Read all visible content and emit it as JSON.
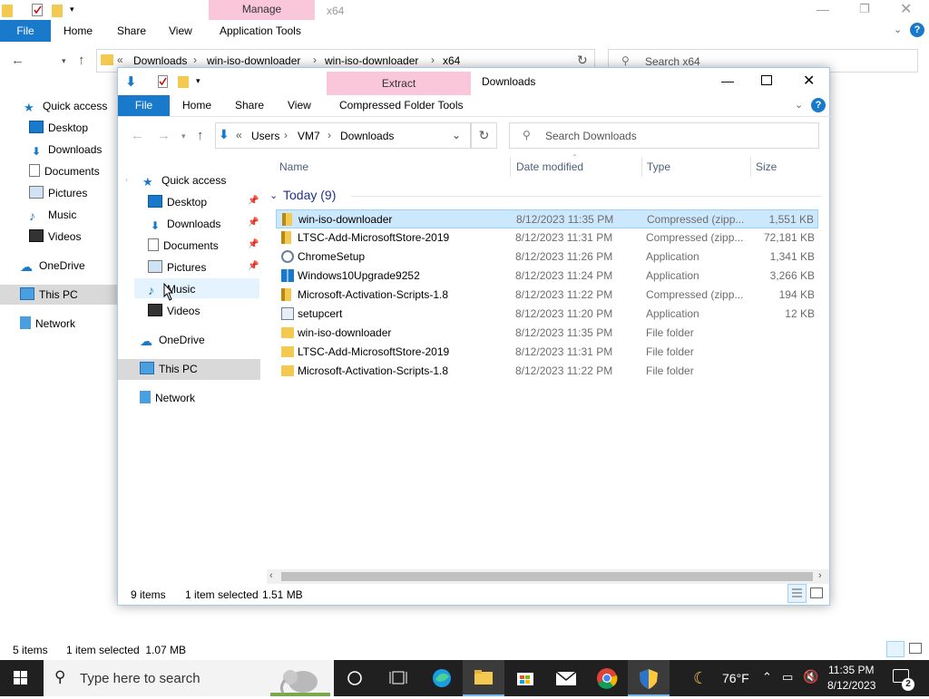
{
  "bg_window": {
    "contextual_tab": "Manage",
    "title": "x64",
    "tabs": {
      "file": "File",
      "home": "Home",
      "share": "Share",
      "view": "View",
      "tools": "Application Tools"
    },
    "breadcrumb": {
      "prefix": "«",
      "items": [
        "Downloads",
        "win-iso-downloader",
        "win-iso-downloader",
        "x64"
      ]
    },
    "search_placeholder": "Search x64",
    "nav": {
      "quick_access": "Quick access",
      "desktop": "Desktop",
      "downloads": "Downloads",
      "documents": "Documents",
      "pictures": "Pictures",
      "music": "Music",
      "videos": "Videos",
      "onedrive": "OneDrive",
      "this_pc": "This PC",
      "network": "Network"
    },
    "status": {
      "items": "5 items",
      "selected": "1 item selected  1.07 MB"
    }
  },
  "window": {
    "contextual_tab": "Extract",
    "title": "Downloads",
    "tabs": {
      "file": "File",
      "home": "Home",
      "share": "Share",
      "view": "View",
      "tools": "Compressed Folder Tools"
    },
    "breadcrumb": {
      "prefix": "«",
      "items": [
        "Users",
        "VM7",
        "Downloads"
      ]
    },
    "search_placeholder": "Search Downloads",
    "nav": {
      "quick_access": "Quick access",
      "desktop": "Desktop",
      "downloads": "Downloads",
      "documents": "Documents",
      "pictures": "Pictures",
      "music": "Music",
      "videos": "Videos",
      "onedrive": "OneDrive",
      "this_pc": "This PC",
      "network": "Network"
    },
    "columns": {
      "name": "Name",
      "date": "Date modified",
      "type": "Type",
      "size": "Size"
    },
    "group": "Today (9)",
    "files": [
      {
        "name": "win-iso-downloader",
        "date": "8/12/2023 11:35 PM",
        "type": "Compressed (zipp...",
        "size": "1,551 KB",
        "icon": "zip-icon"
      },
      {
        "name": "LTSC-Add-MicrosoftStore-2019",
        "date": "8/12/2023 11:31 PM",
        "type": "Compressed (zipp...",
        "size": "72,181 KB",
        "icon": "zip-icon"
      },
      {
        "name": "ChromeSetup",
        "date": "8/12/2023 11:26 PM",
        "type": "Application",
        "size": "1,341 KB",
        "icon": "setup-icon"
      },
      {
        "name": "Windows10Upgrade9252",
        "date": "8/12/2023 11:24 PM",
        "type": "Application",
        "size": "3,266 KB",
        "icon": "windows-icon"
      },
      {
        "name": "Microsoft-Activation-Scripts-1.8",
        "date": "8/12/2023 11:22 PM",
        "type": "Compressed (zipp...",
        "size": "194 KB",
        "icon": "zip-icon"
      },
      {
        "name": "setupcert",
        "date": "8/12/2023 11:20 PM",
        "type": "Application",
        "size": "12 KB",
        "icon": "app-icon"
      },
      {
        "name": "win-iso-downloader",
        "date": "8/12/2023 11:35 PM",
        "type": "File folder",
        "size": "",
        "icon": "folder-icon"
      },
      {
        "name": "LTSC-Add-MicrosoftStore-2019",
        "date": "8/12/2023 11:31 PM",
        "type": "File folder",
        "size": "",
        "icon": "folder-icon"
      },
      {
        "name": "Microsoft-Activation-Scripts-1.8",
        "date": "8/12/2023 11:22 PM",
        "type": "File folder",
        "size": "",
        "icon": "folder-icon"
      }
    ],
    "status": {
      "items": "9 items",
      "selected": "1 item selected",
      "size": "1.51 MB"
    }
  },
  "taskbar": {
    "search_placeholder": "Type here to search",
    "weather": "76°F",
    "time": "11:35 PM",
    "date": "8/12/2023",
    "notification_count": "2"
  },
  "colors": {
    "accent": "#1979ca",
    "selection": "#cce8ff",
    "contextual_tab": "#f9c7d9",
    "taskbar": "#202020"
  }
}
